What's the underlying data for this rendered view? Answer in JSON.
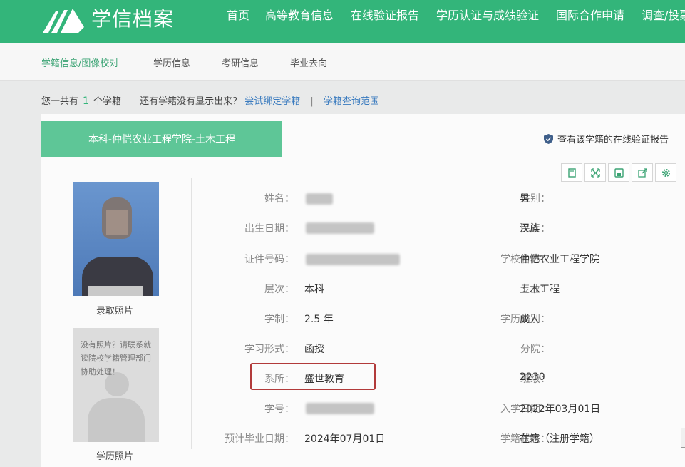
{
  "header": {
    "brand": "学信档案",
    "nav": [
      "首页",
      "高等教育信息",
      "在线验证报告",
      "学历认证与成绩验证",
      "国际合作申请",
      "调查/投票"
    ]
  },
  "subnav": [
    "学籍信息/图像校对",
    "学历信息",
    "考研信息",
    "毕业去向"
  ],
  "info": {
    "prefix": "您一共有",
    "count": "1",
    "suffix": "个学籍",
    "question": "还有学籍没有显示出来？",
    "bind_link": "尝试绑定学籍",
    "separator": "|",
    "scope_link": "学籍查询范围"
  },
  "record": {
    "tab_title": "本科-仲恺农业工程学院-土木工程",
    "verify_link": "查看该学籍的在线验证报告",
    "tools": [
      "book-icon",
      "expand-icon",
      "save-icon",
      "share-icon",
      "settings-icon"
    ],
    "photo1_caption": "录取照片",
    "photo2_caption": "学历照片",
    "photo2_note": "没有照片？请联系就读院校学籍管理部门协助处理！"
  },
  "fields_left": [
    {
      "label": "姓名：",
      "value": ""
    },
    {
      "label": "出生日期：",
      "value": ""
    },
    {
      "label": "证件号码：",
      "value": ""
    },
    {
      "label": "层次：",
      "value": "本科"
    },
    {
      "label": "学制：",
      "value": "2.5 年"
    },
    {
      "label": "学习形式：",
      "value": "函授"
    },
    {
      "label": "系所：",
      "value": "盛世教育"
    },
    {
      "label": "学号：",
      "value": ""
    },
    {
      "label": "预计毕业日期：",
      "value": "2024年07月01日"
    }
  ],
  "fields_right": [
    {
      "label": "性别：",
      "value": "男"
    },
    {
      "label": "民族：",
      "value": "汉族"
    },
    {
      "label": "学校名称：",
      "value": "仲恺农业工程学院"
    },
    {
      "label": "专业：",
      "value": "土木工程"
    },
    {
      "label": "学历类别：",
      "value": "成人"
    },
    {
      "label": "分院：",
      "value": ""
    },
    {
      "label": "班级：",
      "value": "2230"
    },
    {
      "label": "入学日期：",
      "value": "2022年03月01日"
    },
    {
      "label": "学籍状态：",
      "value": "在籍（注册学籍）"
    }
  ],
  "colors": {
    "brand_green": "#33b57a",
    "tab_green": "#5ec697",
    "highlight_red": "#b23a3a"
  }
}
